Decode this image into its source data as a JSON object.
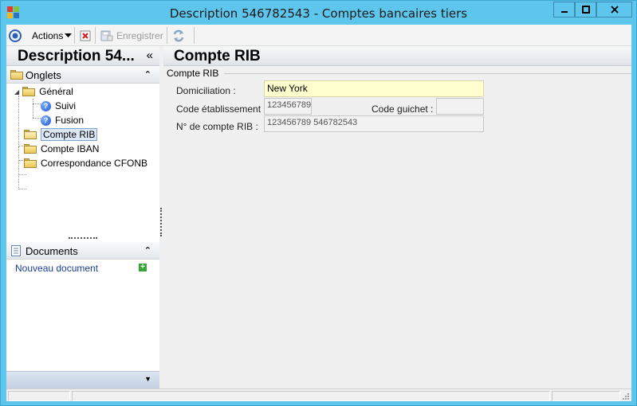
{
  "window": {
    "title": "Description 546782543 -  Comptes bancaires tiers",
    "icon_colors": [
      "#e23b2e",
      "#7ec242",
      "#f2b620",
      "#2a74c7"
    ]
  },
  "toolbar": {
    "actions_label": "Actions",
    "save_label": "Enregistrer"
  },
  "left": {
    "title": "Description 54...",
    "collapse_glyph": "«",
    "sections": {
      "onglets": "Onglets",
      "documents": "Documents"
    },
    "tree": [
      {
        "label": "Général",
        "type": "folder",
        "expanded": true
      },
      {
        "label": "Suivi",
        "type": "help"
      },
      {
        "label": "Fusion",
        "type": "help"
      },
      {
        "label": "Compte RIB",
        "type": "folder-open",
        "selected": true
      },
      {
        "label": "Compte IBAN",
        "type": "folder"
      },
      {
        "label": "Correspondance CFONB",
        "type": "folder"
      }
    ],
    "new_document": "Nouveau document"
  },
  "main": {
    "title": "Compte RIB",
    "group": "Compte RIB",
    "fields": {
      "domiciliation": {
        "label": "Domiciliation :",
        "value": "New York"
      },
      "code_etablissement": {
        "label": "Code établissement :",
        "value": "123456789"
      },
      "code_guichet": {
        "label": "Code guichet :",
        "value": ""
      },
      "numero_compte": {
        "label": "N° de compte RIB :",
        "value": "123456789 546782543"
      }
    }
  },
  "colors": {
    "titlebar": "#5ec6ec",
    "editable_field": "#ffffcf",
    "link": "#1c3d94"
  }
}
